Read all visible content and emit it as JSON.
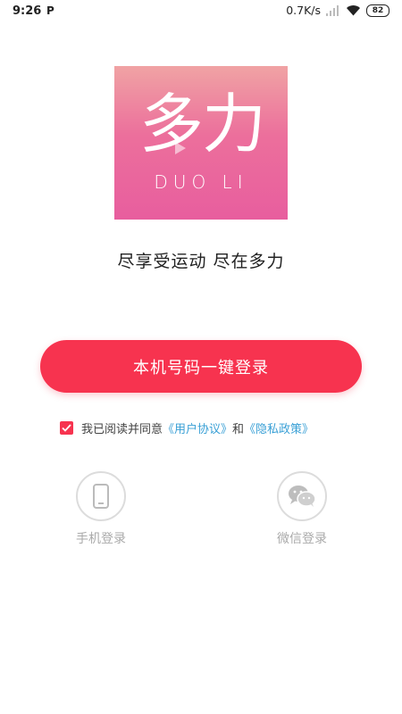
{
  "status_bar": {
    "time": "9:26",
    "app_indicator": "P",
    "network_speed": "0.7K/s",
    "battery_level": "82"
  },
  "logo": {
    "chinese_text": "多力",
    "english_text": "DUO LI",
    "gradient_top": "#f0a3a4",
    "gradient_bottom": "#e85e9e"
  },
  "slogan": "尽享受运动 尽在多力",
  "one_click_login": {
    "label": "本机号码一键登录",
    "color": "#f7334f"
  },
  "agreement": {
    "checked": true,
    "prefix": "我已阅读并同意",
    "user_agreement": "《用户协议》",
    "conjunction": "和",
    "privacy_policy": "《隐私政策》"
  },
  "alt_logins": {
    "phone": {
      "label": "手机登录",
      "icon": "phone-icon"
    },
    "wechat": {
      "label": "微信登录",
      "icon": "wechat-icon"
    }
  }
}
